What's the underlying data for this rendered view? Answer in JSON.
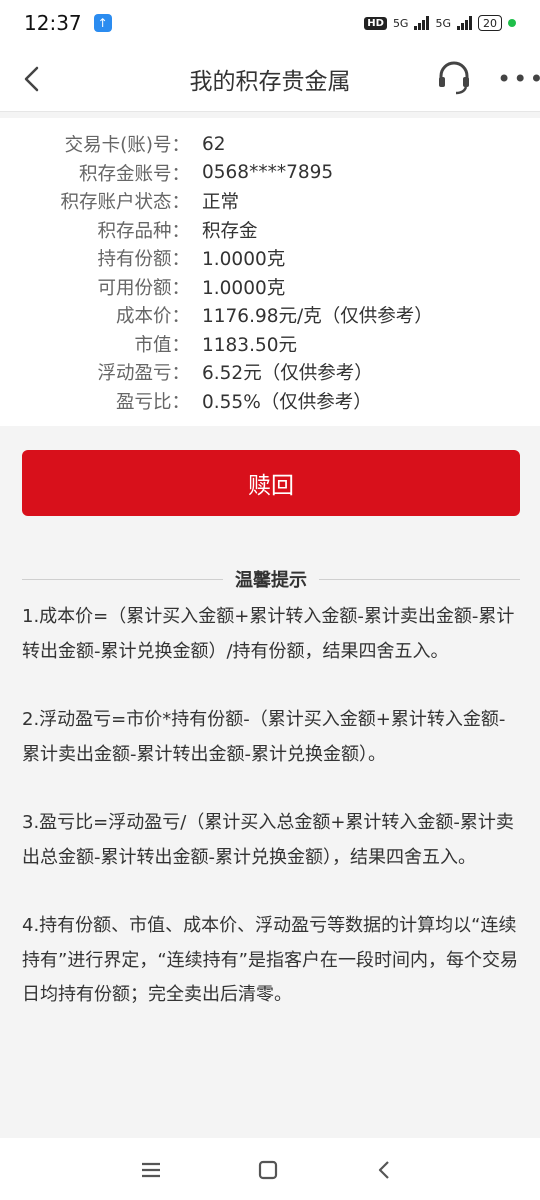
{
  "status": {
    "time": "12:37",
    "hd": "HD",
    "net1": "5G",
    "net2": "5G",
    "battery": "20"
  },
  "header": {
    "title": "我的积存贵金属"
  },
  "account": {
    "rows": [
      {
        "label": "交易卡(账)号：",
        "value": "62"
      },
      {
        "label": "积存金账号：",
        "value": "0568****7895"
      },
      {
        "label": "积存账户状态：",
        "value": "正常"
      },
      {
        "label": "积存品种：",
        "value": "积存金"
      },
      {
        "label": "持有份额：",
        "value": "1.0000克"
      },
      {
        "label": "可用份额：",
        "value": "1.0000克"
      },
      {
        "label": "成本价：",
        "value": "1176.98元/克（仅供参考）"
      },
      {
        "label": "市值：",
        "value": "1183.50元"
      },
      {
        "label": "浮动盈亏：",
        "value": "6.52元（仅供参考）"
      },
      {
        "label": "盈亏比：",
        "value": "0.55%（仅供参考）"
      }
    ]
  },
  "action": {
    "redeem_label": "赎回"
  },
  "tips": {
    "heading": "温馨提示",
    "items": [
      "1.成本价=（累计买入金额+累计转入金额-累计卖出金额-累计转出金额-累计兑换金额）/持有份额，结果四舍五入。",
      "2.浮动盈亏=市价*持有份额-（累计买入金额+累计转入金额-累计卖出金额-累计转出金额-累计兑换金额）。",
      "3.盈亏比=浮动盈亏/（累计买入总金额+累计转入金额-累计卖出总金额-累计转出金额-累计兑换金额），结果四舍五入。",
      "4.持有份额、市值、成本价、浮动盈亏等数据的计算均以“连续持有”进行界定，“连续持有”是指客户在一段时间内，每个交易日均持有份额；完全卖出后清零。"
    ]
  },
  "colors": {
    "accent": "#d8101b",
    "background": "#f4f4f4"
  }
}
